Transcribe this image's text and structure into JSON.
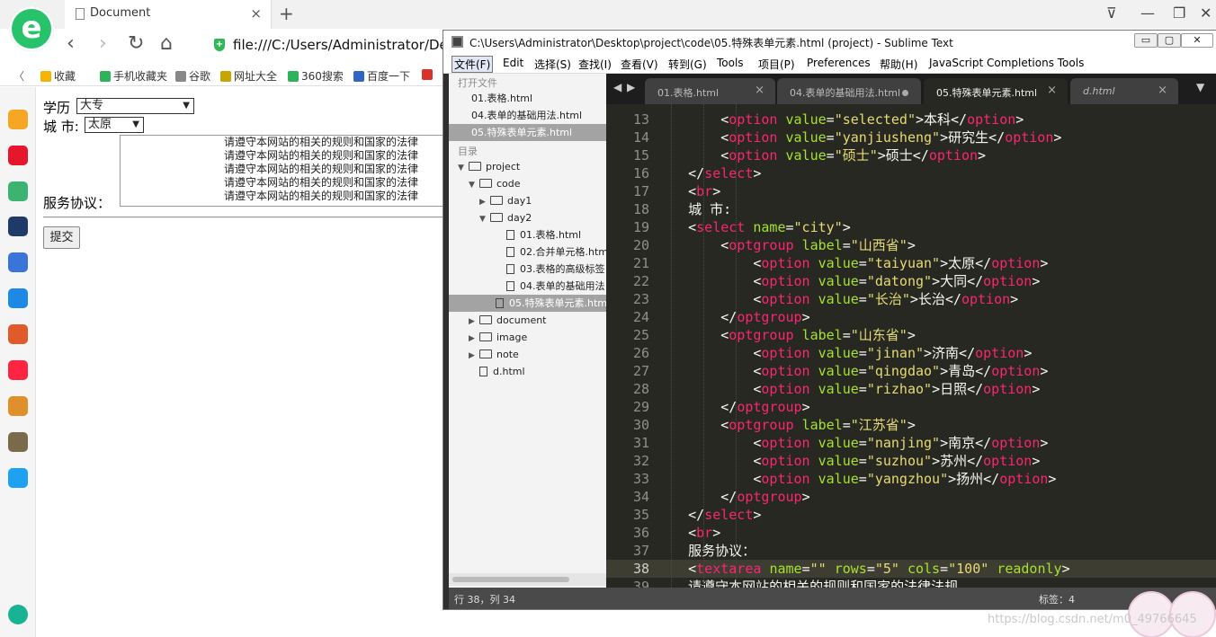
{
  "browser": {
    "logo_letter": "e",
    "tab": {
      "title": "Document",
      "close": "×"
    },
    "new_tab": "+",
    "window_controls": [
      "⊽",
      "—",
      "❐",
      "✕"
    ],
    "nav": {
      "back": "‹",
      "forward": "›",
      "reload": "↻",
      "home": "⌂"
    },
    "url": "file:///C:/Users/Administrator/Desk",
    "favorites_toggle": "〈",
    "favorites": [
      {
        "label": "收藏",
        "color": "#f4b400"
      },
      {
        "label": "手机收藏夹",
        "color": "#2eb35b"
      },
      {
        "label": "谷歌",
        "color": "#888888"
      },
      {
        "label": "网址大全",
        "color": "#c7a500"
      },
      {
        "label": "360搜索",
        "color": "#2eb35b"
      },
      {
        "label": "百度一下",
        "color": "#3266c4"
      },
      {
        "label": "",
        "color": "#d9322a"
      }
    ],
    "sidebar_icons": [
      {
        "name": "star-icon",
        "color": "#f5a623"
      },
      {
        "name": "weibo-icon",
        "color": "#e6162d"
      },
      {
        "name": "mail-icon",
        "color": "#3cb371"
      },
      {
        "name": "news-icon",
        "color": "#1f3a68"
      },
      {
        "name": "document-icon",
        "color": "#3a74d8"
      },
      {
        "name": "chat-icon",
        "color": "#1e88e5"
      },
      {
        "name": "game-icon",
        "color": "#e05a2a"
      },
      {
        "name": "xiaohongshu-icon",
        "color": "#ff2442"
      },
      {
        "name": "game2-icon",
        "color": "#e0902a"
      },
      {
        "name": "pubg-icon",
        "color": "#7a6a4a"
      },
      {
        "name": "p-app-icon",
        "color": "#1da1f2"
      },
      {
        "name": "add-icon",
        "color": "#19b394"
      }
    ]
  },
  "page": {
    "education_label": "学历",
    "education_value": "大专",
    "city_label": "城 市:",
    "city_value": "太原",
    "agreement_label": "服务协议：",
    "agreement_lines": [
      "请遵守本网站的相关的规则和国家的法律",
      "请遵守本网站的相关的规则和国家的法律",
      "请遵守本网站的相关的规则和国家的法律",
      "请遵守本网站的相关的规则和国家的法律",
      "请遵守本网站的相关的规则和国家的法律"
    ],
    "submit_label": "提交"
  },
  "sublime": {
    "title": "C:\\Users\\Administrator\\Desktop\\project\\code\\05.特殊表单元素.html (project) - Sublime Text",
    "title_buttons": [
      "▭",
      "▢",
      "✕"
    ],
    "menu": [
      "文件(F)",
      "Edit",
      "选择(S)",
      "查找(I)",
      "查看(V)",
      "转到(G)",
      "Tools",
      "项目(P)",
      "Preferences",
      "帮助(H)",
      "JavaScript Completions Tools"
    ],
    "open_files_header": "打开文件",
    "open_files": [
      "01.表格.html",
      "04.表单的基础用法.html",
      "05.特殊表单元素.html"
    ],
    "folders_header": "目录",
    "tree": [
      {
        "label": "project",
        "arrow": "▼",
        "kind": "folder"
      },
      {
        "label": "code",
        "arrow": "▼",
        "kind": "folder"
      },
      {
        "label": "day1",
        "arrow": "▶",
        "kind": "folder"
      },
      {
        "label": "day2",
        "arrow": "▼",
        "kind": "folder"
      },
      {
        "label": "01.表格.html",
        "arrow": "",
        "kind": "file"
      },
      {
        "label": "02.合并单元格.htm",
        "arrow": "",
        "kind": "file"
      },
      {
        "label": "03.表格的高级标签",
        "arrow": "",
        "kind": "file"
      },
      {
        "label": "04.表单的基础用法",
        "arrow": "",
        "kind": "file"
      },
      {
        "label": "05.特殊表单元素.htm",
        "arrow": "",
        "kind": "file"
      },
      {
        "label": "document",
        "arrow": "▶",
        "kind": "folder"
      },
      {
        "label": "image",
        "arrow": "▶",
        "kind": "folder"
      },
      {
        "label": "note",
        "arrow": "▶",
        "kind": "folder"
      },
      {
        "label": "d.html",
        "arrow": "",
        "kind": "file"
      }
    ],
    "nav_arrows": [
      "◀",
      "▶"
    ],
    "overflow_arrow": "▼",
    "tabs": [
      {
        "label": "01.表格.html",
        "marker": "×"
      },
      {
        "label": "04.表单的基础用法.html",
        "marker": "dot"
      },
      {
        "label": "05.特殊表单元素.html",
        "marker": "×"
      },
      {
        "label": "d.html",
        "marker": "×"
      }
    ],
    "status_position": "行 38，列 34",
    "status_indent": "标签：4"
  },
  "code_lines": [
    {
      "n": "13",
      "t": [
        [
          "        ",
          ""
        ],
        [
          "<",
          ""
        ],
        [
          "option",
          "tg"
        ],
        [
          " ",
          ""
        ],
        [
          "value",
          "at"
        ],
        [
          "=",
          ""
        ],
        [
          "\"selected\"",
          "st"
        ],
        [
          ">本科</",
          ""
        ],
        [
          "option",
          "tg"
        ],
        [
          ">",
          ""
        ]
      ]
    },
    {
      "n": "14",
      "t": [
        [
          "        ",
          ""
        ],
        [
          "<",
          ""
        ],
        [
          "option",
          "tg"
        ],
        [
          " ",
          ""
        ],
        [
          "value",
          "at"
        ],
        [
          "=",
          ""
        ],
        [
          "\"yanjiusheng\"",
          "st"
        ],
        [
          ">研究生</",
          ""
        ],
        [
          "option",
          "tg"
        ],
        [
          ">",
          ""
        ]
      ]
    },
    {
      "n": "15",
      "t": [
        [
          "        ",
          ""
        ],
        [
          "<",
          ""
        ],
        [
          "option",
          "tg"
        ],
        [
          " ",
          ""
        ],
        [
          "value",
          "at"
        ],
        [
          "=",
          ""
        ],
        [
          "\"硕士\"",
          "st"
        ],
        [
          ">硕士</",
          ""
        ],
        [
          "option",
          "tg"
        ],
        [
          ">",
          ""
        ]
      ]
    },
    {
      "n": "16",
      "t": [
        [
          "    </",
          ""
        ],
        [
          "select",
          "tg"
        ],
        [
          ">",
          ""
        ]
      ]
    },
    {
      "n": "17",
      "t": [
        [
          "    <",
          ""
        ],
        [
          "br",
          "tg"
        ],
        [
          ">",
          ""
        ]
      ]
    },
    {
      "n": "18",
      "t": [
        [
          "    城 市:",
          ""
        ]
      ]
    },
    {
      "n": "19",
      "t": [
        [
          "    <",
          ""
        ],
        [
          "select",
          "tg"
        ],
        [
          " ",
          ""
        ],
        [
          "name",
          "at"
        ],
        [
          "=",
          ""
        ],
        [
          "\"city\"",
          "st"
        ],
        [
          ">",
          ""
        ]
      ]
    },
    {
      "n": "20",
      "t": [
        [
          "        <",
          ""
        ],
        [
          "optgroup",
          "tg"
        ],
        [
          " ",
          ""
        ],
        [
          "label",
          "at"
        ],
        [
          "=",
          ""
        ],
        [
          "\"山西省\"",
          "st"
        ],
        [
          ">",
          ""
        ]
      ]
    },
    {
      "n": "21",
      "t": [
        [
          "            <",
          ""
        ],
        [
          "option",
          "tg"
        ],
        [
          " ",
          ""
        ],
        [
          "value",
          "at"
        ],
        [
          "=",
          ""
        ],
        [
          "\"taiyuan\"",
          "st"
        ],
        [
          ">太原</",
          ""
        ],
        [
          "option",
          "tg"
        ],
        [
          ">",
          ""
        ]
      ]
    },
    {
      "n": "22",
      "t": [
        [
          "            <",
          ""
        ],
        [
          "option",
          "tg"
        ],
        [
          " ",
          ""
        ],
        [
          "value",
          "at"
        ],
        [
          "=",
          ""
        ],
        [
          "\"datong\"",
          "st"
        ],
        [
          ">大同</",
          ""
        ],
        [
          "option",
          "tg"
        ],
        [
          ">",
          ""
        ]
      ]
    },
    {
      "n": "23",
      "t": [
        [
          "            <",
          ""
        ],
        [
          "option",
          "tg"
        ],
        [
          " ",
          ""
        ],
        [
          "value",
          "at"
        ],
        [
          "=",
          ""
        ],
        [
          "\"长治\"",
          "st"
        ],
        [
          ">长治</",
          ""
        ],
        [
          "option",
          "tg"
        ],
        [
          ">",
          ""
        ]
      ]
    },
    {
      "n": "24",
      "t": [
        [
          "        </",
          ""
        ],
        [
          "optgroup",
          "tg"
        ],
        [
          ">",
          ""
        ]
      ]
    },
    {
      "n": "25",
      "t": [
        [
          "        <",
          ""
        ],
        [
          "optgroup",
          "tg"
        ],
        [
          " ",
          ""
        ],
        [
          "label",
          "at"
        ],
        [
          "=",
          ""
        ],
        [
          "\"山东省\"",
          "st"
        ],
        [
          ">",
          ""
        ]
      ]
    },
    {
      "n": "26",
      "t": [
        [
          "            <",
          ""
        ],
        [
          "option",
          "tg"
        ],
        [
          " ",
          ""
        ],
        [
          "value",
          "at"
        ],
        [
          "=",
          ""
        ],
        [
          "\"jinan\"",
          "st"
        ],
        [
          ">济南</",
          ""
        ],
        [
          "option",
          "tg"
        ],
        [
          ">",
          ""
        ]
      ]
    },
    {
      "n": "27",
      "t": [
        [
          "            <",
          ""
        ],
        [
          "option",
          "tg"
        ],
        [
          " ",
          ""
        ],
        [
          "value",
          "at"
        ],
        [
          "=",
          ""
        ],
        [
          "\"qingdao\"",
          "st"
        ],
        [
          ">青岛</",
          ""
        ],
        [
          "option",
          "tg"
        ],
        [
          ">",
          ""
        ]
      ]
    },
    {
      "n": "28",
      "t": [
        [
          "            <",
          ""
        ],
        [
          "option",
          "tg"
        ],
        [
          " ",
          ""
        ],
        [
          "value",
          "at"
        ],
        [
          "=",
          ""
        ],
        [
          "\"rizhao\"",
          "st"
        ],
        [
          ">日照</",
          ""
        ],
        [
          "option",
          "tg"
        ],
        [
          ">",
          ""
        ]
      ]
    },
    {
      "n": "29",
      "t": [
        [
          "        </",
          ""
        ],
        [
          "optgroup",
          "tg"
        ],
        [
          ">",
          ""
        ]
      ]
    },
    {
      "n": "30",
      "t": [
        [
          "        <",
          ""
        ],
        [
          "optgroup",
          "tg"
        ],
        [
          " ",
          ""
        ],
        [
          "label",
          "at"
        ],
        [
          "=",
          ""
        ],
        [
          "\"江苏省\"",
          "st"
        ],
        [
          ">",
          ""
        ]
      ]
    },
    {
      "n": "31",
      "t": [
        [
          "            <",
          ""
        ],
        [
          "option",
          "tg"
        ],
        [
          " ",
          ""
        ],
        [
          "value",
          "at"
        ],
        [
          "=",
          ""
        ],
        [
          "\"nanjing\"",
          "st"
        ],
        [
          ">南京</",
          ""
        ],
        [
          "option",
          "tg"
        ],
        [
          ">",
          ""
        ]
      ]
    },
    {
      "n": "32",
      "t": [
        [
          "            <",
          ""
        ],
        [
          "option",
          "tg"
        ],
        [
          " ",
          ""
        ],
        [
          "value",
          "at"
        ],
        [
          "=",
          ""
        ],
        [
          "\"suzhou\"",
          "st"
        ],
        [
          ">苏州</",
          ""
        ],
        [
          "option",
          "tg"
        ],
        [
          ">",
          ""
        ]
      ]
    },
    {
      "n": "33",
      "t": [
        [
          "            <",
          ""
        ],
        [
          "option",
          "tg"
        ],
        [
          " ",
          ""
        ],
        [
          "value",
          "at"
        ],
        [
          "=",
          ""
        ],
        [
          "\"yangzhou\"",
          "st"
        ],
        [
          ">扬州</",
          ""
        ],
        [
          "option",
          "tg"
        ],
        [
          ">",
          ""
        ]
      ]
    },
    {
      "n": "34",
      "t": [
        [
          "        </",
          ""
        ],
        [
          "optgroup",
          "tg"
        ],
        [
          ">",
          ""
        ]
      ]
    },
    {
      "n": "35",
      "t": [
        [
          "    </",
          ""
        ],
        [
          "select",
          "tg"
        ],
        [
          ">",
          ""
        ]
      ]
    },
    {
      "n": "36",
      "t": [
        [
          "    <",
          ""
        ],
        [
          "br",
          "tg"
        ],
        [
          ">",
          ""
        ]
      ]
    },
    {
      "n": "37",
      "t": [
        [
          "    服务协议：",
          ""
        ]
      ]
    },
    {
      "n": "38",
      "t": [
        [
          "    <",
          ""
        ],
        [
          "textarea",
          "tg"
        ],
        [
          " ",
          ""
        ],
        [
          "name",
          "at"
        ],
        [
          "=",
          ""
        ],
        [
          "\"\"",
          "st"
        ],
        [
          " ",
          ""
        ],
        [
          "rows",
          "at"
        ],
        [
          "=",
          ""
        ],
        [
          "\"5\"",
          "st"
        ],
        [
          " ",
          ""
        ],
        [
          "cols",
          "at"
        ],
        [
          "=",
          ""
        ],
        [
          "\"100\"",
          "st"
        ],
        [
          " ",
          ""
        ],
        [
          "readonly",
          "at"
        ],
        [
          ">",
          ""
        ]
      ]
    },
    {
      "n": "39",
      "t": [
        [
          "    请遵守本网站的相关的规则和国家的法律法规......",
          ""
        ]
      ]
    }
  ],
  "current_line": "38",
  "watermark": "https://blog.csdn.net/m0_49766645"
}
